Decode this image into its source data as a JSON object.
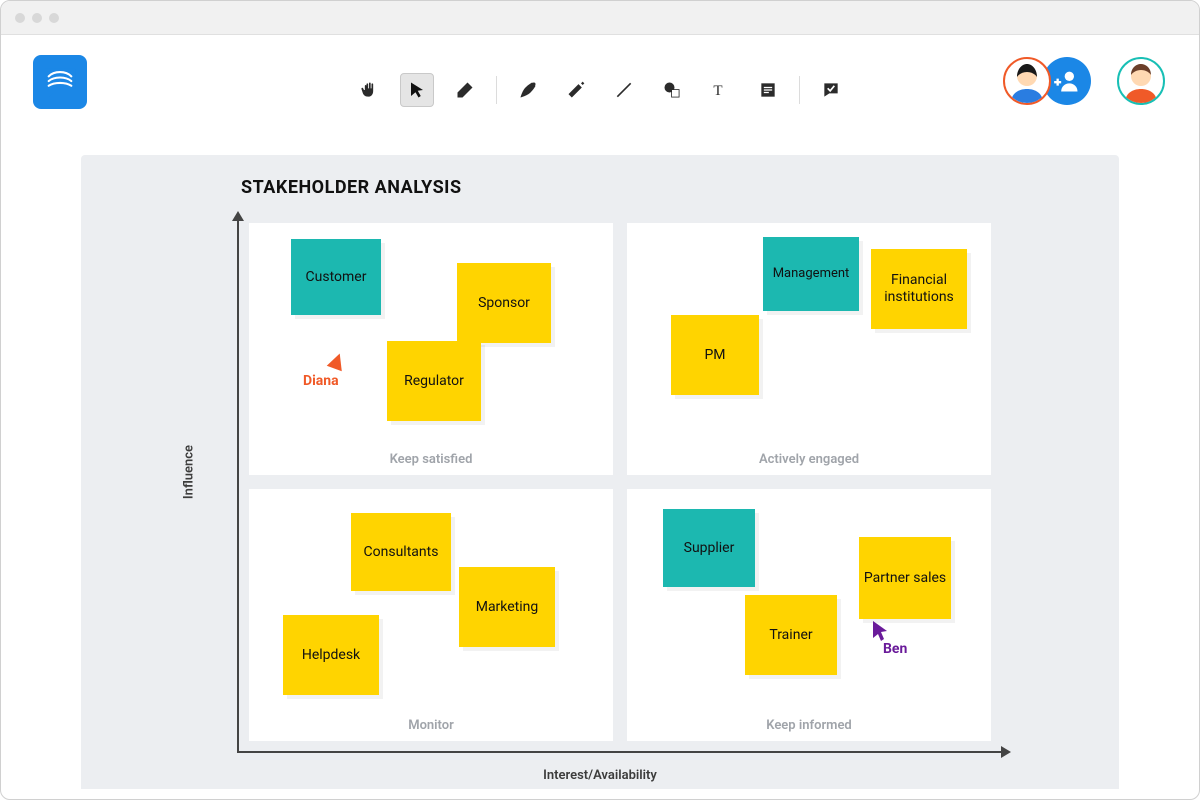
{
  "toolbar": {
    "tools": [
      "hand",
      "select",
      "eraser",
      "pen",
      "marker",
      "line",
      "shape",
      "text",
      "sticky",
      "stamp"
    ],
    "selected": "select"
  },
  "collaborators": {
    "add_label": "Add collaborator",
    "users": [
      {
        "name": "Diana",
        "color": "#f05a28"
      },
      {
        "name": "Ben",
        "color": "#6a1b9a"
      }
    ]
  },
  "diagram": {
    "title": "STAKEHOLDER ANALYSIS",
    "y_axis": "Influence",
    "x_axis": "Interest/Availability",
    "quadrants": {
      "top_left": "Keep satisfied",
      "top_right": "Actively engaged",
      "bottom_left": "Monitor",
      "bottom_right": "Keep informed"
    },
    "notes": {
      "customer": "Customer",
      "sponsor": "Sponsor",
      "regulator": "Regulator",
      "management": "Management",
      "fin_inst": "Financial institutions",
      "pm": "PM",
      "consultants": "Consultants",
      "marketing": "Marketing",
      "helpdesk": "Helpdesk",
      "supplier": "Supplier",
      "trainer": "Trainer",
      "partner_sales": "Partner sales"
    },
    "cursors": {
      "diana": "Diana",
      "ben": "Ben"
    }
  }
}
